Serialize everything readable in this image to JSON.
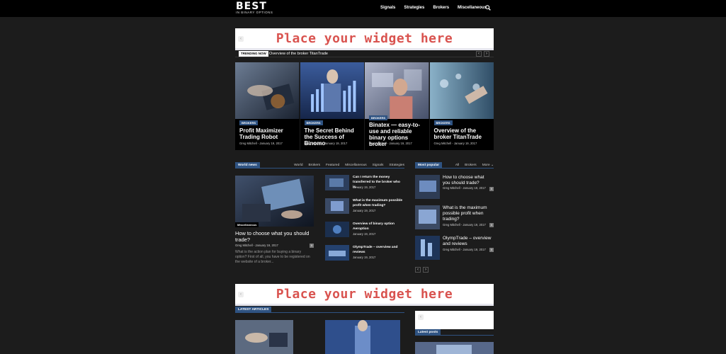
{
  "header": {
    "logo_title": "BEST",
    "logo_subtitle": "IN BINARY OPTIONS",
    "nav": [
      "Signals",
      "Strategies",
      "Brokers",
      "Miscellaneous"
    ],
    "search_icon": "search-icon"
  },
  "ads": {
    "top_text": "Place your widget here",
    "bottom_text": "Place your widget here",
    "arrow": "‹"
  },
  "trending": {
    "label": "TRENDING NOW",
    "title": "Overview of the broker TitanTrade",
    "prev": "‹",
    "next": "›"
  },
  "featured": [
    {
      "category": "BROKERS",
      "title": "Profit Maximizer Trading Robot",
      "author": "Greg Mitchell",
      "date": "January 19, 2017"
    },
    {
      "category": "BROKERS",
      "title": "The Secret Behind the Success of Binomo",
      "author": "Greg Mitchell",
      "date": "January 19, 2017"
    },
    {
      "category": "BROKERS",
      "title": "Binatex — easy-to-use and reliable binary options broker",
      "author": "Greg Mitchell",
      "date": "January 19, 2017"
    },
    {
      "category": "BROKERS",
      "title": "Overview of the broker TitanTrade",
      "author": "Greg Mitchell",
      "date": "January 19, 2017"
    }
  ],
  "world_news": {
    "label": "World news",
    "tabs": [
      "World",
      "Brokers",
      "Featured",
      "Miscellaneous",
      "Signals",
      "Strategies"
    ],
    "main": {
      "category": "Miscellaneous",
      "title": "How to choose what you should trade?",
      "author": "Greg Mitchell",
      "date": "January 19, 2017",
      "comments": "0",
      "excerpt": "What is the action plan for buying a binary option? First of all, you have to be registered on the website of a broker..."
    },
    "items": [
      {
        "title": "Can I return the money transferred to the broker who is...",
        "date": "January 19, 2017"
      },
      {
        "title": "What is the maximum possible profit when trading?",
        "date": "January 19, 2017"
      },
      {
        "title": "Overview of binary option Aeroption",
        "date": "January 19, 2017"
      },
      {
        "title": "OlympTrade – overview and reviews",
        "date": "January 19, 2017"
      }
    ]
  },
  "most_popular": {
    "label": "Most popular",
    "tabs": [
      "All",
      "Brokers",
      "More"
    ],
    "items": [
      {
        "title": "How to choose what you should trade?",
        "author": "Greg Mitchell",
        "date": "January 19, 2017",
        "comments": "0"
      },
      {
        "title": "What is the maximum possible profit when trading?",
        "author": "Greg Mitchell",
        "date": "January 19, 2017",
        "comments": "0"
      },
      {
        "title": "OlympTrade – overview and reviews",
        "author": "Greg Mitchell",
        "date": "January 19, 2017",
        "comments": "0"
      }
    ],
    "prev": "‹",
    "next": "›"
  },
  "latest": {
    "label": "LATEST ARTICLES",
    "sidebar_label": "Latest posts"
  },
  "colors": {
    "accent": "#2f5382",
    "background": "#1c1c1c",
    "ad_text": "#d9534f"
  }
}
